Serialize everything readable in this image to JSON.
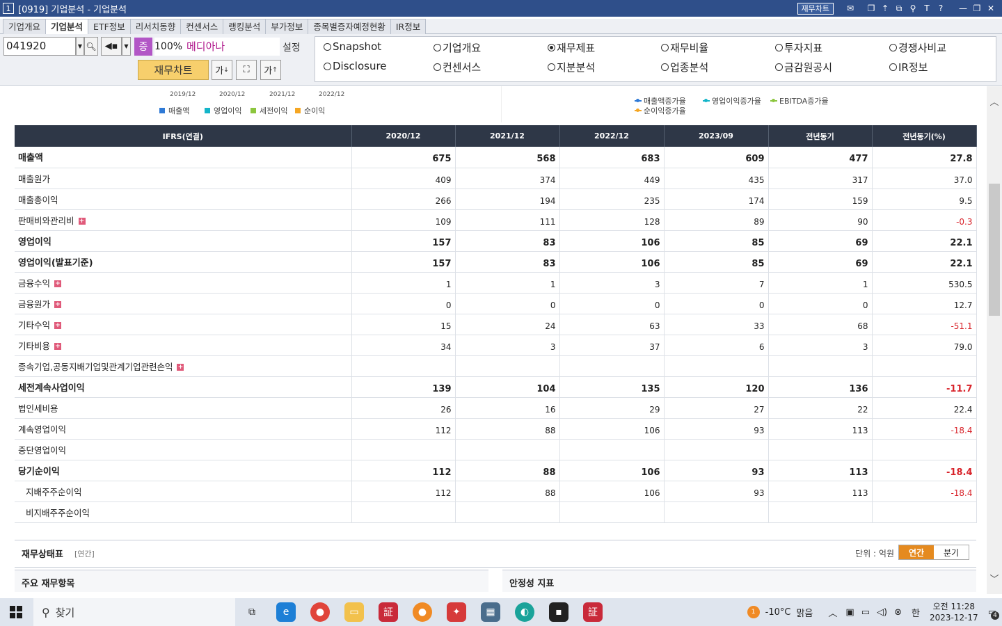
{
  "window": {
    "num": "1",
    "title": "[0919] 기업분석 - 기업분석",
    "chart_button": "재무차트"
  },
  "menu_tabs": [
    "기업개요",
    "기업분석",
    "ETF정보",
    "리서치동향",
    "컨센서스",
    "랭킹분석",
    "부가정보",
    "종목별증자예정현황",
    "IR정보"
  ],
  "controls": {
    "code": "041920",
    "badge": "증",
    "pct": "100%",
    "company": "메디아나",
    "setting": "설정",
    "finchart": "재무차트",
    "font_btn": "가"
  },
  "radios": [
    {
      "label": "Snapshot",
      "selected": false
    },
    {
      "label": "기업개요",
      "selected": false
    },
    {
      "label": "재무제표",
      "selected": true
    },
    {
      "label": "재무비율",
      "selected": false
    },
    {
      "label": "투자지표",
      "selected": false
    },
    {
      "label": "경쟁사비교",
      "selected": false
    },
    {
      "label": "Disclosure",
      "selected": false
    },
    {
      "label": "컨센서스",
      "selected": false
    },
    {
      "label": "지분분석",
      "selected": false
    },
    {
      "label": "업종분석",
      "selected": false
    },
    {
      "label": "금감원공시",
      "selected": false
    },
    {
      "label": "IR정보",
      "selected": false
    }
  ],
  "chart_area": {
    "x_ticks": [
      "2019/12",
      "2020/12",
      "2021/12",
      "2022/12"
    ],
    "legend_left": [
      {
        "label": "매출액",
        "color": "#2f7ad6"
      },
      {
        "label": "영업이익",
        "color": "#14b5c9"
      },
      {
        "label": "세전이익",
        "color": "#8cc63e"
      },
      {
        "label": "순이익",
        "color": "#f5a623"
      }
    ],
    "legend_right": [
      {
        "label": "매출액증가율",
        "color": "#2f7ad6"
      },
      {
        "label": "영업이익증가율",
        "color": "#14b5c9"
      },
      {
        "label": "EBITDA증가율",
        "color": "#8cc63e"
      },
      {
        "label": "순이익증가율",
        "color": "#f5a623"
      }
    ]
  },
  "table": {
    "headers": [
      "IFRS(연결)",
      "2020/12",
      "2021/12",
      "2022/12",
      "2023/09",
      "전년동기",
      "전년동기(%)"
    ],
    "rows": [
      {
        "label": "매출액",
        "bold": true,
        "sep": false,
        "plus": false,
        "sub": false,
        "values": [
          "675",
          "568",
          "683",
          "609",
          "477",
          "27.8"
        ]
      },
      {
        "label": "매출원가",
        "bold": false,
        "sep": false,
        "plus": false,
        "sub": false,
        "values": [
          "409",
          "374",
          "449",
          "435",
          "317",
          "37.0"
        ]
      },
      {
        "label": "매출총이익",
        "bold": false,
        "sep": false,
        "plus": false,
        "sub": false,
        "values": [
          "266",
          "194",
          "235",
          "174",
          "159",
          "9.5"
        ]
      },
      {
        "label": "판매비와관리비",
        "bold": false,
        "sep": false,
        "plus": true,
        "sub": false,
        "values": [
          "109",
          "111",
          "128",
          "89",
          "90",
          "-0.3"
        ]
      },
      {
        "label": "영업이익",
        "bold": true,
        "sep": true,
        "plus": false,
        "sub": false,
        "values": [
          "157",
          "83",
          "106",
          "85",
          "69",
          "22.1"
        ]
      },
      {
        "label": "영업이익(발표기준)",
        "bold": true,
        "sep": false,
        "plus": false,
        "sub": false,
        "values": [
          "157",
          "83",
          "106",
          "85",
          "69",
          "22.1"
        ]
      },
      {
        "label": "금융수익",
        "bold": false,
        "sep": false,
        "plus": true,
        "sub": false,
        "values": [
          "1",
          "1",
          "3",
          "7",
          "1",
          "530.5"
        ]
      },
      {
        "label": "금융원가",
        "bold": false,
        "sep": false,
        "plus": true,
        "sub": false,
        "values": [
          "0",
          "0",
          "0",
          "0",
          "0",
          "12.7"
        ]
      },
      {
        "label": "기타수익",
        "bold": false,
        "sep": false,
        "plus": true,
        "sub": false,
        "values": [
          "15",
          "24",
          "63",
          "33",
          "68",
          "-51.1"
        ]
      },
      {
        "label": "기타비용",
        "bold": false,
        "sep": false,
        "plus": true,
        "sub": false,
        "values": [
          "34",
          "3",
          "37",
          "6",
          "3",
          "79.0"
        ]
      },
      {
        "label": "종속기업,공동지배기업및관계기업관련손익",
        "bold": false,
        "sep": false,
        "plus": true,
        "sub": false,
        "values": [
          "",
          "",
          "",
          "",
          "",
          ""
        ]
      },
      {
        "label": "세전계속사업이익",
        "bold": true,
        "sep": true,
        "plus": false,
        "sub": false,
        "values": [
          "139",
          "104",
          "135",
          "120",
          "136",
          "-11.7"
        ]
      },
      {
        "label": "법인세비용",
        "bold": false,
        "sep": false,
        "plus": false,
        "sub": false,
        "values": [
          "26",
          "16",
          "29",
          "27",
          "22",
          "22.4"
        ]
      },
      {
        "label": "계속영업이익",
        "bold": false,
        "sep": false,
        "plus": false,
        "sub": false,
        "values": [
          "112",
          "88",
          "106",
          "93",
          "113",
          "-18.4"
        ]
      },
      {
        "label": "중단영업이익",
        "bold": false,
        "sep": false,
        "plus": false,
        "sub": false,
        "values": [
          "",
          "",
          "",
          "",
          "",
          ""
        ]
      },
      {
        "label": "당기순이익",
        "bold": true,
        "sep": false,
        "plus": false,
        "sub": false,
        "values": [
          "112",
          "88",
          "106",
          "93",
          "113",
          "-18.4"
        ]
      },
      {
        "label": "지배주주순이익",
        "bold": false,
        "sep": false,
        "plus": false,
        "sub": true,
        "values": [
          "112",
          "88",
          "106",
          "93",
          "113",
          "-18.4"
        ]
      },
      {
        "label": "비지배주주순이익",
        "bold": false,
        "sep": false,
        "plus": false,
        "sub": true,
        "values": [
          "",
          "",
          "",
          "",
          "",
          ""
        ]
      }
    ]
  },
  "balance_sheet": {
    "title": "재무상태표",
    "period": "[연간]",
    "unit": "단위 : 억원",
    "toggle_annual": "연간",
    "toggle_quarter": "분기",
    "left_header": "주요 재무항목",
    "right_header": "안정성 지표"
  },
  "taskbar": {
    "search": "찾기",
    "weather_temp": "-10°C",
    "weather": "맑음",
    "ime": "한",
    "time": "오전 11:28",
    "date": "2023-12-17",
    "notif_count": "4",
    "weather_badge": "1"
  },
  "colors": {
    "title_bar": "#2f4f8a",
    "table_header": "#2e3747",
    "negative": "#d8232a",
    "accent_toggle": "#e58a1f",
    "finchart_button": "#f7cf6c"
  }
}
